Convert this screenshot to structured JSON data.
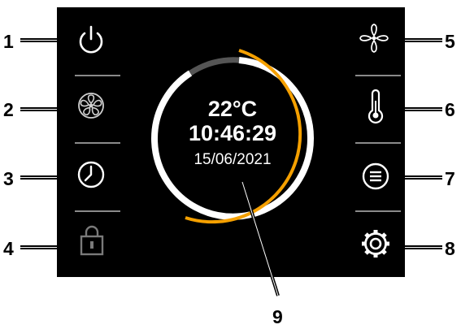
{
  "display": {
    "temperature": "22°C",
    "time": "10:46:29",
    "date": "15/06/2021",
    "accent_color": "#f5a000",
    "ring_color": "#ffffff",
    "ring_track_color": "#555555"
  },
  "left_buttons": [
    {
      "callout": "1",
      "icon": "power-icon"
    },
    {
      "callout": "2",
      "icon": "fan-icon"
    },
    {
      "callout": "3",
      "icon": "clock-icon"
    },
    {
      "callout": "4",
      "icon": "lock-icon"
    }
  ],
  "right_buttons": [
    {
      "callout": "5",
      "icon": "fan-icon"
    },
    {
      "callout": "6",
      "icon": "thermometer-icon"
    },
    {
      "callout": "7",
      "icon": "menu-icon"
    },
    {
      "callout": "8",
      "icon": "gear-icon"
    }
  ],
  "dial_callout": "9"
}
